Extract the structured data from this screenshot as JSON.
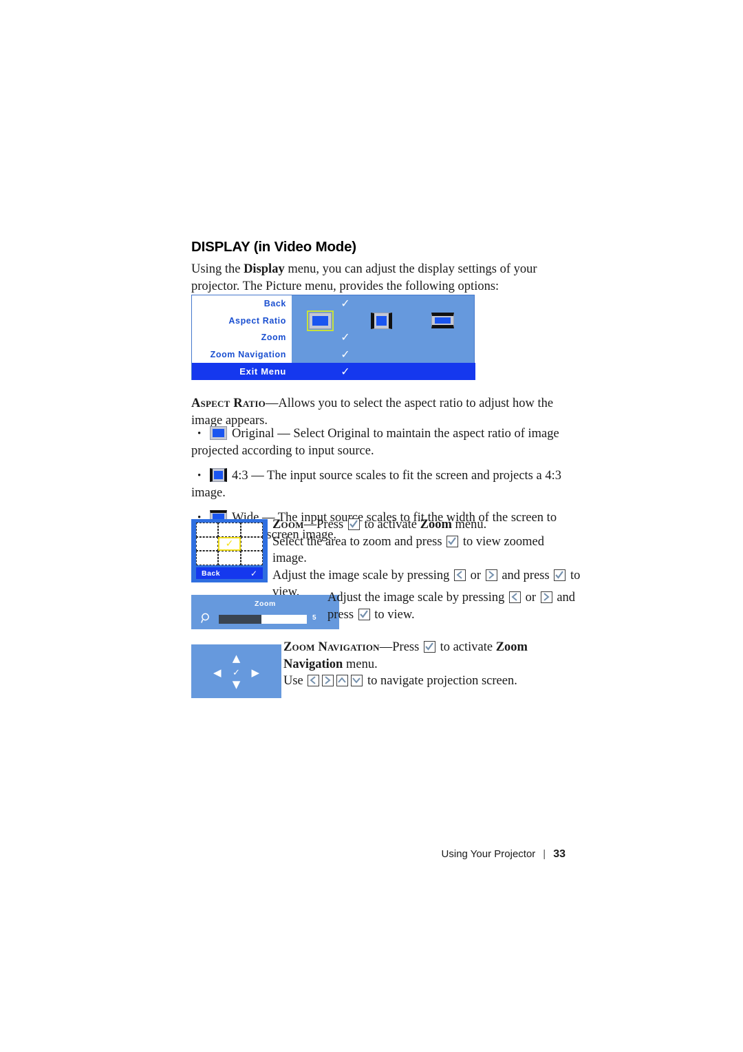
{
  "page": {
    "heading": "DISPLAY (in Video Mode)",
    "intro_before": "Using the ",
    "intro_bold": "Display",
    "intro_after": " menu, you can adjust the display settings of your projector. The Picture menu, provides the following options:"
  },
  "osd_menu": {
    "rows": [
      {
        "label": "Back",
        "value_icon": "check-icon"
      },
      {
        "label": "Aspect Ratio",
        "value_icon": "aspect-ratio-icons"
      },
      {
        "label": "Zoom",
        "value_icon": "check-icon"
      },
      {
        "label": "Zoom Navigation",
        "value_icon": "check-icon"
      }
    ],
    "exit": {
      "label": "Exit Menu",
      "value_icon": "check-icon"
    },
    "aspect_icons": [
      {
        "name": "original",
        "selected": true
      },
      {
        "name": "4-3",
        "selected": false
      },
      {
        "name": "wide",
        "selected": false
      }
    ],
    "colors": {
      "panel_bg": "#6699dd",
      "label_col_bg": "#ffffff",
      "label_text": "#1a4fd0",
      "exit_bar_bg": "#1538ee",
      "selection_outline": "#c9e23a"
    }
  },
  "aspect_ratio_section": {
    "term": "Aspect Ratio",
    "dash": "—",
    "description": "Allows you to select the aspect ratio to adjust how the image appears.",
    "bullets": [
      {
        "icon": "aspect-original-icon",
        "text": "Original — Select Original to maintain the aspect ratio of image projected according to input source."
      },
      {
        "icon": "aspect-4-3-icon",
        "text": "4:3 — The input source scales to fit the screen and projects a 4:3 image."
      },
      {
        "icon": "aspect-wide-icon",
        "text": "Wide — The input source scales to fit the width of the screen to project a wide screen image."
      }
    ],
    "bullet_char": "•"
  },
  "zoom_section": {
    "term": "Zoom",
    "dash": "—",
    "line1_a": "Press ",
    "line1_key": "enter-key-icon",
    "line1_b": " to activate ",
    "line1_bold": "Zoom",
    "line1_c": " menu.",
    "line2_a": "Select the area to zoom and press ",
    "line2_key": "enter-key-icon",
    "line2_b": " to view zoomed image.",
    "line3_a": "Adjust the image scale by pressing ",
    "line3_key1": "left-arrow-key-icon",
    "line3_b": " or ",
    "line3_key2": "right-arrow-key-icon",
    "line3_c": " and press ",
    "line3_key3": "enter-key-icon",
    "line3_d": " to view."
  },
  "zoom_grid_panel": {
    "back_label": "Back",
    "back_icon": "check-icon",
    "selected_cell_icon": "check-icon",
    "selected_cell_index": 4,
    "cells": 9
  },
  "zoom_slider_panel": {
    "title": "Zoom",
    "magnifier_icon": "magnifier-icon",
    "value": "5",
    "fill_percent": 48
  },
  "zoom_scale_para": {
    "a": "Adjust the image scale by pressing ",
    "key1": "left-arrow-key-icon",
    "b": " or ",
    "key2": "right-arrow-key-icon",
    "c": " and press ",
    "key3": "enter-key-icon",
    "d": " to view."
  },
  "nav_panel": {
    "up_icon": "arrow-up-icon",
    "down_icon": "arrow-down-icon",
    "left_icon": "arrow-left-icon",
    "right_icon": "arrow-right-icon",
    "center_icon": "check-icon"
  },
  "zoom_navigation_section": {
    "term": "Zoom Navigation",
    "dash": "—",
    "line1_a": "Press ",
    "line1_key": "enter-key-icon",
    "line1_b": " to activate ",
    "line1_bold": "Zoom Navigation",
    "line1_c": " menu.",
    "line2_a": "Use ",
    "line2_keys": [
      "left-arrow-key-icon",
      "right-arrow-key-icon",
      "up-arrow-key-icon",
      "down-arrow-key-icon"
    ],
    "line2_b": " to navigate projection screen."
  },
  "footer": {
    "title": "Using Your Projector",
    "separator": "|",
    "page_number": "33"
  }
}
